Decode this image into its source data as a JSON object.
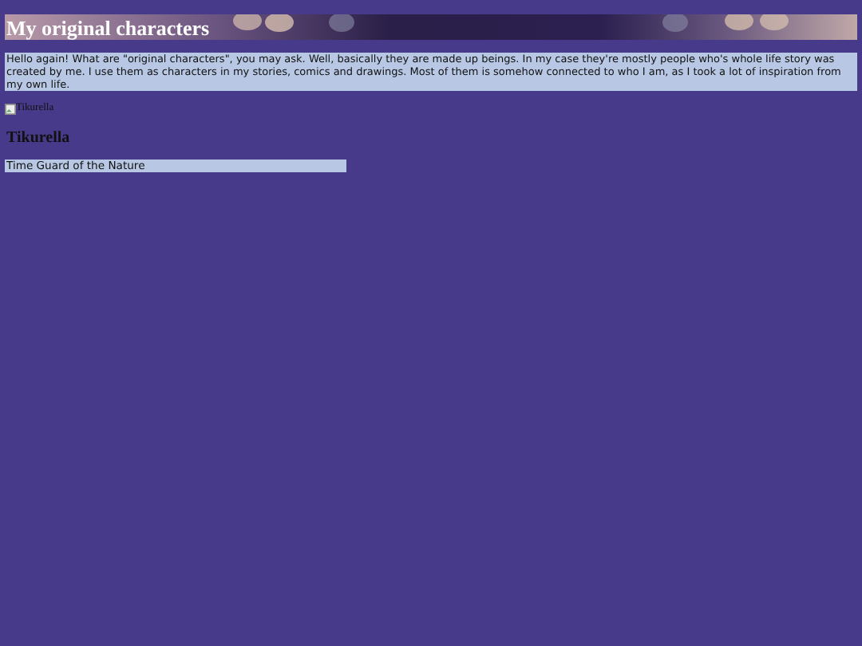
{
  "header": {
    "title": "My original characters"
  },
  "intro": "Hello again! What are \"original characters\", you may ask. Well, basically they are made up beings. In my case they're mostly people who's whole life story was created by me. I use them as characters in my stories, comics and drawings. Most of them is somehow connected to who I am, as I took a lot of inspiration from my own life.",
  "characters": [
    {
      "image_alt": "Tikurella",
      "name": "Tikurella",
      "subtitle": "Time Guard of the Nature"
    }
  ]
}
